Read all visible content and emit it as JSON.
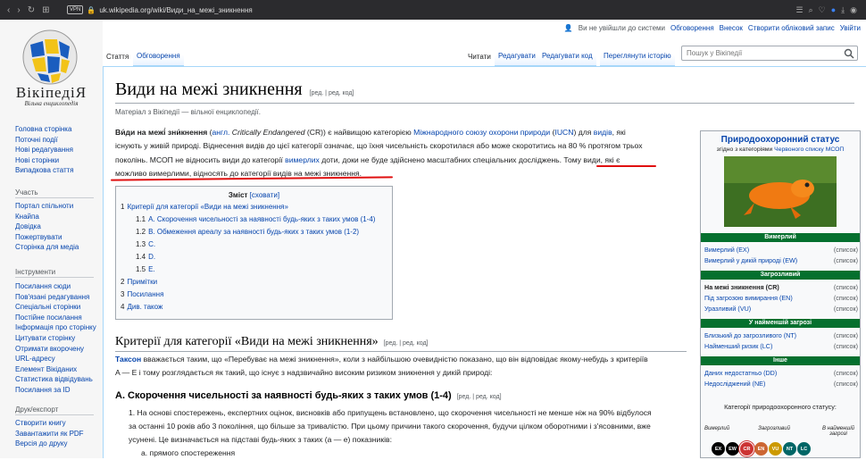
{
  "browser": {
    "url": "uk.wikipedia.org/wiki/Види_на_межі_зникнення",
    "vpn": "VPN"
  },
  "site": {
    "wordmark": "ВікіпедіЯ",
    "tagline": "Вільна енциклопедія"
  },
  "personal": {
    "not_logged": "Ви не увійшли до системи",
    "links": [
      "Обговорення",
      "Внесок",
      "Створити обліковий запис",
      "Увійти"
    ]
  },
  "tabs": {
    "left": [
      "Стаття",
      "Обговорення"
    ],
    "right": [
      "Читати",
      "Редагувати",
      "Редагувати код",
      "Переглянути історію"
    ]
  },
  "search": {
    "placeholder": "Пошук у Вікіпедії"
  },
  "sidebar": {
    "nav": [
      "Головна сторінка",
      "Поточні події",
      "Нові редагування",
      "Нові сторінки",
      "Випадкова стаття"
    ],
    "participation_head": "Участь",
    "participation": [
      "Портал спільноти",
      "Кнайпа",
      "Довідка",
      "Пожертвувати",
      "Сторінка для медіа"
    ],
    "tools_head": "Інструменти",
    "tools": [
      "Посилання сюди",
      "Пов'язані редагування",
      "Спеціальні сторінки",
      "Постійне посилання",
      "Інформація про сторінку",
      "Цитувати сторінку",
      "Отримати вкорочену",
      "URL-адресу",
      "Елемент Вікіданих",
      "Статистика відвідувань",
      "Посилання за ID"
    ],
    "print_head": "Друк/експорт",
    "print": [
      "Створити книгу",
      "Завантажити як PDF",
      "Версія до друку"
    ]
  },
  "article": {
    "title": "Види на межі зникнення",
    "title_edit": "[ред. | ред. код]",
    "from": "Матеріал з Вікіпедії — вільної енциклопедії.",
    "lead": {
      "l1a": "Ви́ди на межі́ зни́кнення",
      "l1b": " (",
      "l1c": "англ.",
      "l1d": " Critically Endangered",
      "l1e": " (CR)) є найвищою категорією ",
      "l1f": "Міжнародного союзу охорони природи",
      "l1g": " (",
      "l1h": "IUCN",
      "l1i": ") для ",
      "l1j": "видів",
      "l1k": ", які",
      "l2": "існують у живій природі. Віднесення видів до цієї категорії означає, що їхня чисельність скоротилася або може скоротитись на 80 % протягом трьох",
      "l3a": "поколінь. МСОП не відносить види до категорії ",
      "l3b": "вимерлих",
      "l3c": " доти, доки не буде здійснено масштабних спеціальних досліджень. ",
      "l3d": "Тому види, які є",
      "l4": "можливо вимерлими, відносять до категорії видів на межі зникнення."
    },
    "toc": {
      "title": "Зміст",
      "hide": "[сховати]",
      "items": [
        {
          "num": "1",
          "label": "Критерії для категорії «Види на межі зникнення»"
        },
        {
          "num": "1.1",
          "label": "A. Скорочення чисельності за наявності будь-яких з таких умов (1-4)"
        },
        {
          "num": "1.2",
          "label": "B. Обмеження ареалу за наявності будь-яких з таких умов (1-2)"
        },
        {
          "num": "1.3",
          "label": "C."
        },
        {
          "num": "1.4",
          "label": "D."
        },
        {
          "num": "1.5",
          "label": "E."
        },
        {
          "num": "2",
          "label": "Примітки"
        },
        {
          "num": "3",
          "label": "Посилання"
        },
        {
          "num": "4",
          "label": "Див. також"
        }
      ]
    },
    "section1": {
      "title": "Критерії для категорії «Види на межі зникнення»",
      "edit": "[ред. | ред. код]"
    },
    "para2": {
      "a": "Таксон",
      "b": " вважається таким, що «Перебуває на межі зникнення», коли з найбільшою очевидністю показано, що він відповідає якому-небудь з критеріїв",
      "c": "A — E і тому розглядається як такий, що існує з надзвичайно високим ризиком зникнення у дикій природі:"
    },
    "section2": {
      "title": "A. Скорочення чисельності за наявності будь-яких з таких умов (1-4)",
      "edit": "[ред. | ред. код]"
    },
    "para3": {
      "l1": "1. На основі спостережень, експертних оцінок, висновків або припущень встановлено, що скорочення чисельності не менше ніж на 90% відбулося",
      "l2": "за останні 10 років або 3 покоління, що більше за триваліс‍тю. При цьому причини такого скорочення, будучи цілком оборотними і з'ясовними, вже",
      "l3": "усунені. Це визначається на підставі будь-яких з таких (а — е) показників:",
      "l4": "a. прямого спостереження"
    }
  },
  "infobox": {
    "title": "Природоохоронний статус",
    "subtitle_a": "згідно з категоріями ",
    "subtitle_b": "Червоного списку МСОП",
    "bands": [
      "Вимерлий",
      "Загрозливий",
      "У найменшій загрозі",
      "Інше"
    ],
    "rows": [
      {
        "label": "Вимерлий (EX)",
        "bold": false
      },
      {
        "label": "Вимерлий у дикій природі (EW)",
        "bold": false
      },
      {
        "label": "На межі зникнення (CR)",
        "bold": true
      },
      {
        "label": "Під загрозою вимирання (EN)",
        "bold": false
      },
      {
        "label": "Уразливий (VU)",
        "bold": false
      },
      {
        "label": "Близький до загрозливого (NT)",
        "bold": false
      },
      {
        "label": "Найменший ризик (LC)",
        "bold": false
      },
      {
        "label": "Даних недостатньо (DD)",
        "bold": false
      },
      {
        "label": "Недосліджений (NE)",
        "bold": false
      }
    ],
    "list_label": "(список)",
    "category_note": "Категорії природоохоронного статусу:",
    "scale": [
      "Вимерлий",
      "Загрозливий",
      "В найменшій загрозі"
    ],
    "codes": [
      "EX",
      "EW",
      "CR",
      "EN",
      "VU",
      "NT",
      "LC"
    ],
    "code_colors": [
      "#000000",
      "#000000",
      "#cc3333",
      "#cc6633",
      "#cc9900",
      "#006666",
      "#006666"
    ]
  }
}
